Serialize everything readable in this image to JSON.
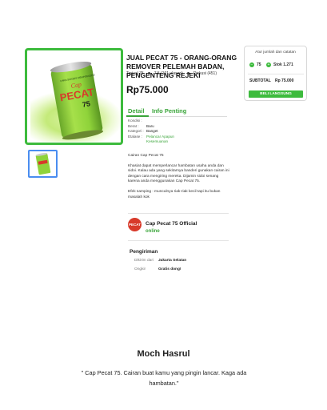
{
  "product": {
    "title": "JUAL PECAT 75 - ORANG-ORANG REMOVER PELEMAH BADAN, PENGENTENG REJEKI",
    "sold": "Terjual 75",
    "rating": "7.5 (101 ulasan)",
    "discussion": "Diskusi (451)",
    "price": "Rp75.000",
    "can_label_top": "Cap",
    "can_label_main": "PECAT",
    "can_label_num": "75",
    "can_label_sub": "CARA SUKSES MEMPERCEPAT"
  },
  "tabs": [
    {
      "label": "Detail"
    },
    {
      "label": "Info Penting"
    }
  ],
  "specs": [
    {
      "key": "Kondisi :",
      "value": ""
    },
    {
      "key": "Berat :",
      "value": "Baru"
    },
    {
      "key": "Kategori :",
      "value": "Banget"
    },
    {
      "key": "Etalase :",
      "value": "Pelancar Apapun"
    },
    {
      "key": "",
      "value": "Kesemuanan"
    }
  ],
  "description": [
    "Cairan Cap Pecat 75",
    "Khasiat dapat memperlancar hambatan usaha anda dan sidoi. Kalau ada yang sekitarnya banderi gunakan cairan ini dengan cara mengiring mereka. Dijamin sidoi senang karena anda menggunakan Cap Pecat 75.",
    "Efek samping : munculnya riak-riak kecil tapi itu bukan masalah kok"
  ],
  "shop": {
    "logo_text": "PECAT",
    "name": "Cap Pecat 75 Official",
    "status": "online"
  },
  "shipping": {
    "title": "Pengiriman",
    "rows": [
      {
        "key": "Dikirim dari",
        "value": "Jakarta Selatan"
      },
      {
        "key": "Ongkir",
        "value": "Gratis dong!"
      }
    ]
  },
  "buy_box": {
    "header": "Atur jumlah dan catatan",
    "minus": "−",
    "quantity": "75",
    "plus": "+",
    "stock": "Stok 1.271",
    "subtotal_label": "SUBTOTAL",
    "subtotal_value": "Rp 75.000",
    "buy_button": "BELI LANGSUNG"
  },
  "testimonial": {
    "name": "Moch Hasrul",
    "quote": "\" Cap Pecat 75. Cairan buat kamu yang pingin lancar. Kaga ada hambatan.\""
  },
  "colors": {
    "accent": "#3dbb3d",
    "can_green": "#8fd33a",
    "logo_red": "#d83a2a",
    "thumb_border": "#4a8df0"
  }
}
